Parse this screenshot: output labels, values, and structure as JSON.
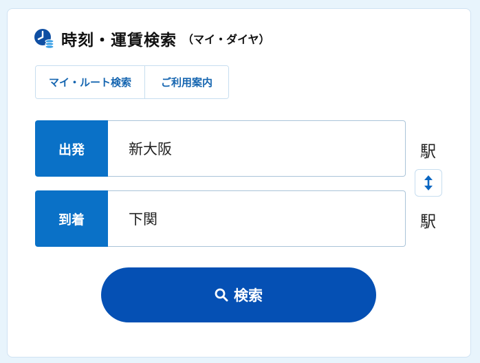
{
  "header": {
    "title": "時刻・運賃検索",
    "subtitle": "（マイ・ダイヤ）",
    "icon": "clock-coins-icon"
  },
  "tabs": [
    {
      "label": "マイ・ルート検索"
    },
    {
      "label": "ご利用案内"
    }
  ],
  "form": {
    "departure": {
      "label": "出発",
      "value": "新大阪",
      "suffix": "駅"
    },
    "arrival": {
      "label": "到着",
      "value": "下関",
      "suffix": "駅"
    },
    "swap_icon": "swap-vertical-icon"
  },
  "search": {
    "label": "検索",
    "icon": "search-icon"
  },
  "colors": {
    "accent": "#0a71c7",
    "button": "#0550b4",
    "link": "#1565b0"
  }
}
